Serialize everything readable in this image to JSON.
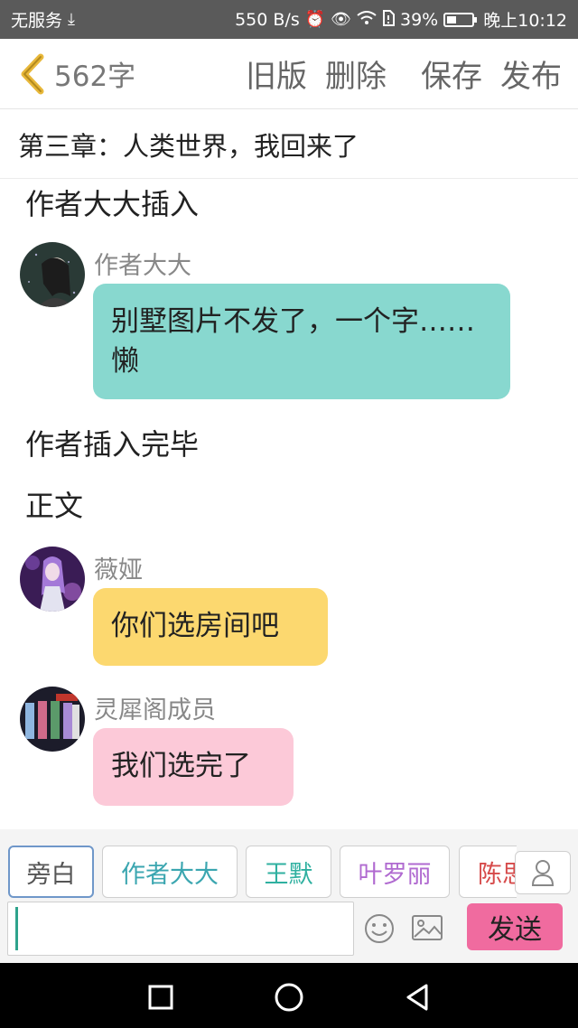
{
  "status_bar": {
    "carrier": "无服务",
    "speed": "550 B/s",
    "battery": "39%",
    "battery_level": 0.39,
    "time": "晚上10:12"
  },
  "top_nav": {
    "word_count": "562字",
    "old_version": "旧版",
    "delete": "删除",
    "save": "保存",
    "publish": "发布"
  },
  "chapter_title": "第三章：人类世界，我回来了",
  "content": {
    "narration_1": "作者大大插入",
    "messages": [
      {
        "name": "作者大大",
        "text": "别墅图片不发了，一个字……懒",
        "bubble_color": "#88d8cf"
      },
      {
        "name": "薇娅",
        "text": "你们选房间吧",
        "bubble_color": "#fcd86f"
      },
      {
        "name": "灵犀阁成员",
        "text": "我们选完了",
        "bubble_color": "#fcc9d8"
      }
    ],
    "narration_2": "作者插入完毕",
    "narration_3": "正文"
  },
  "characters": [
    {
      "label": "旁白",
      "color": "#555555"
    },
    {
      "label": "作者大大",
      "color": "#3ba6b0"
    },
    {
      "label": "王默",
      "color": "#2fb0a0"
    },
    {
      "label": "叶罗丽",
      "color": "#b06ad0"
    },
    {
      "label": "陈思",
      "color": "#d64a4a"
    }
  ],
  "input": {
    "placeholder": "",
    "send": "发送"
  },
  "icons": {
    "back": "chevron-left-icon",
    "user": "user-icon",
    "emoji": "emoji-icon",
    "image": "image-icon"
  },
  "colors": {
    "accent": "#f06b9f",
    "back_arrow": "#e8b83a"
  }
}
